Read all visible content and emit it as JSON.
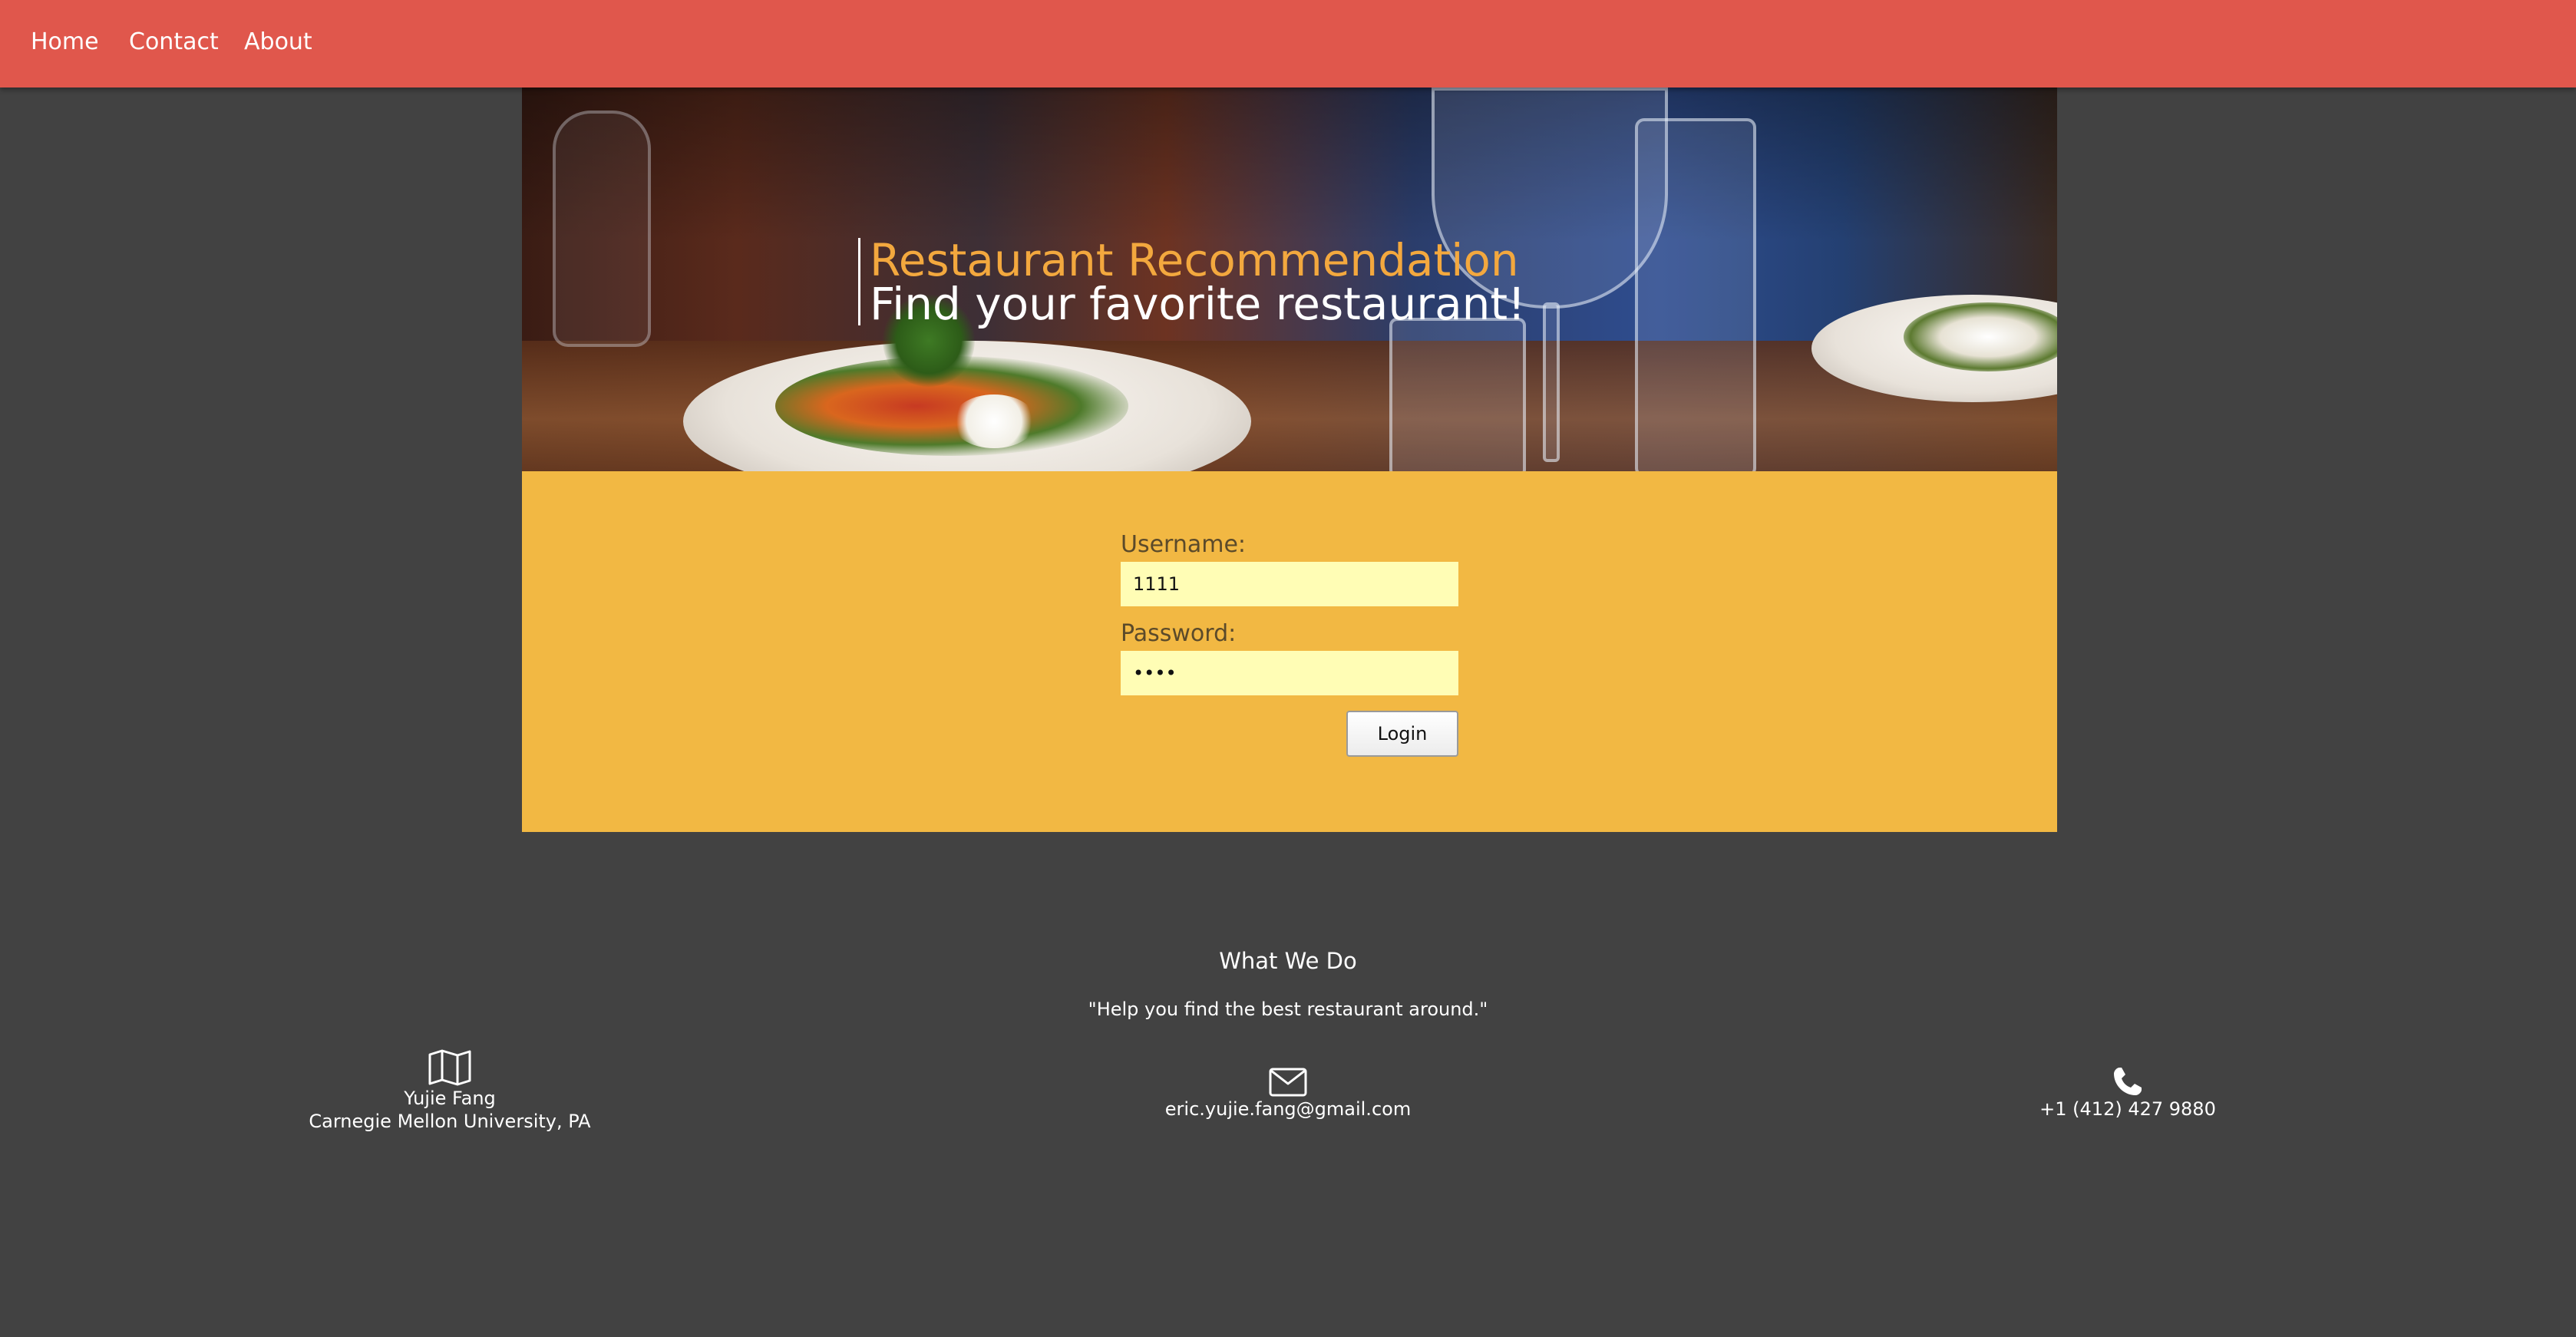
{
  "nav": {
    "links": [
      "Home",
      "Contact",
      "About"
    ]
  },
  "hero": {
    "title": "Restaurant Recommendation",
    "subtitle": "Find your favorite restaurant!"
  },
  "login": {
    "username_label": "Username:",
    "username_value": "1111",
    "password_label": "Password:",
    "password_value": "1111",
    "login_button": "Login"
  },
  "footer": {
    "heading": "What We Do",
    "quote": "\"Help you find the best restaurant around.\"",
    "address": {
      "icon": "map-icon",
      "name": "Yujie Fang",
      "location": "Carnegie Mellon University, PA"
    },
    "email": {
      "icon": "envelope-icon",
      "text": "eric.yujie.fang@gmail.com"
    },
    "phone": {
      "icon": "phone-icon",
      "text": "+1 (412) 427 9880"
    }
  },
  "colors": {
    "navbar": "#e0574c",
    "background": "#424242",
    "login_panel": "#f2b843",
    "hero_title": "#f3a83e",
    "input_bg": "#fffdb5"
  }
}
